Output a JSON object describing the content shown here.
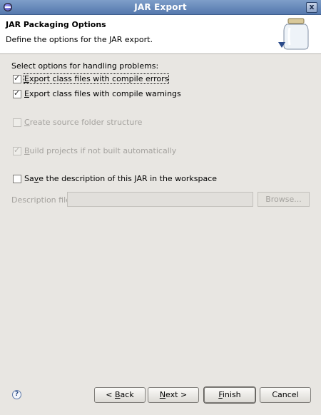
{
  "window": {
    "title": "JAR Export",
    "close_glyph": "x"
  },
  "header": {
    "title": "JAR Packaging Options",
    "description": "Define the options for the JAR export."
  },
  "problems_label": "Select options for handling problems:",
  "options": [
    {
      "mnemonic": "E",
      "rest": "xport class files with compile errors",
      "checked": true,
      "enabled": true,
      "focused": true
    },
    {
      "mnemonic": "E",
      "rest": "xport class files with compile warnings",
      "checked": true,
      "enabled": true,
      "focused": false
    },
    {
      "mnemonic": "C",
      "rest": "reate source folder structure",
      "checked": false,
      "enabled": false
    },
    {
      "mnemonic": "B",
      "rest": "uild projects if not built automatically",
      "checked": true,
      "enabled": false
    }
  ],
  "save_description": {
    "pre": "Sa",
    "mnemonic": "v",
    "post": "e the description of this JAR in the workspace",
    "checked": false
  },
  "description_file": {
    "label": "Description file:",
    "value": "",
    "browse_label": "Browse..."
  },
  "buttons": {
    "back": {
      "pre": "< ",
      "mnemonic": "B",
      "post": "ack"
    },
    "next": {
      "mnemonic": "N",
      "post": "ext >"
    },
    "finish": {
      "mnemonic": "F",
      "post": "inish"
    },
    "cancel": "Cancel"
  },
  "icons": {
    "help": "help-icon",
    "jar": "jar-icon",
    "app": "eclipse-icon",
    "close": "close-icon"
  },
  "colors": {
    "titlebar": "#5f80b4",
    "dialog_bg": "#e8e6e2",
    "header_bg": "#ffffff",
    "disabled_text": "#a4a29e"
  }
}
